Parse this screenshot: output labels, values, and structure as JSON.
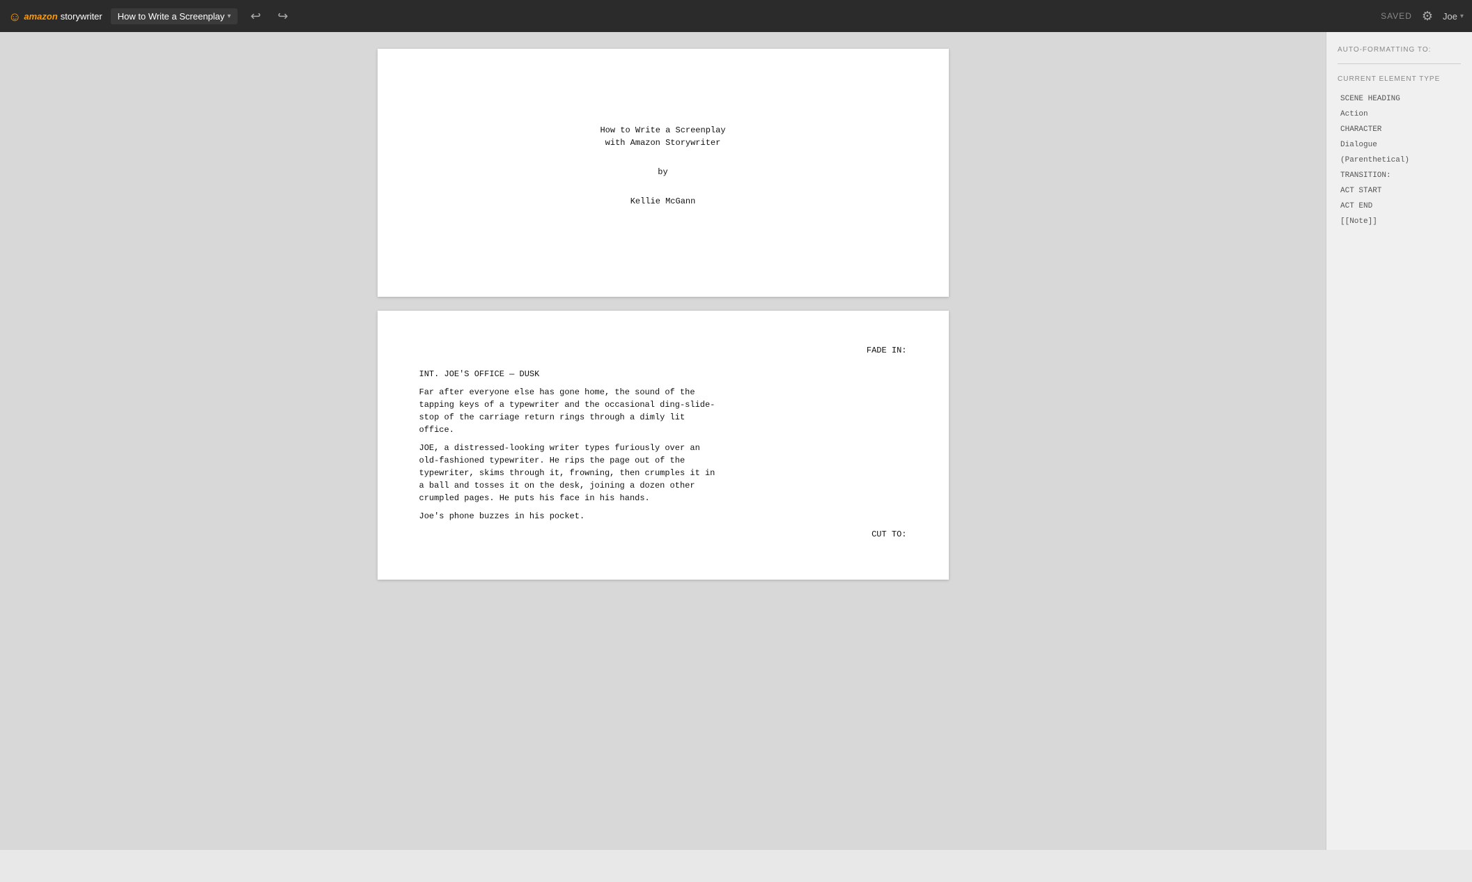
{
  "topbar": {
    "logo_amazon": "amazon",
    "logo_storywriter": "storywriter",
    "logo_smile": "⌣",
    "doc_title": "How to Write a Screenplay",
    "doc_chevron": "▾",
    "undo_icon": "↩",
    "redo_icon": "↪",
    "saved_label": "SAVED",
    "settings_icon": "⚙",
    "user_label": "Joe",
    "user_chevron": "▾"
  },
  "title_page": {
    "line1": "How to Write a Screenplay",
    "line2": "with Amazon Storywriter",
    "by": "by",
    "author": "Kellie McGann"
  },
  "script_page": {
    "fade_in": "FADE IN:",
    "scene_heading": "INT. JOE'S office — DUSK",
    "action1": "Far after everyone else has gone home, the sound of the\ntapping keys of a typewriter and the occasional ding-slide-\nstop of the carriage return rings through a dimly lit\noffice.",
    "action2": "JOE, a distressed-looking writer types furiously over an\nold-fashioned typewriter. He rips the page out of the\ntypewriter, skims through it, frowning, then crumples it in\na ball and tosses it on the desk, joining a dozen other\ncrumpled pages. He puts his face in his hands.",
    "action3": "Joe's phone buzzes in his pocket.",
    "cut_to": "CUT TO:"
  },
  "right_panel": {
    "auto_format_label": "AUTO-FORMATTING TO:",
    "current_element_label": "CURRENT ELEMENT TYPE",
    "element_types": [
      "SCENE HEADING",
      "Action",
      "CHARACTER",
      "Dialogue",
      "(Parenthetical)",
      "TRANSITION:",
      "ACT START",
      "ACT END",
      "[[Note]]"
    ]
  }
}
